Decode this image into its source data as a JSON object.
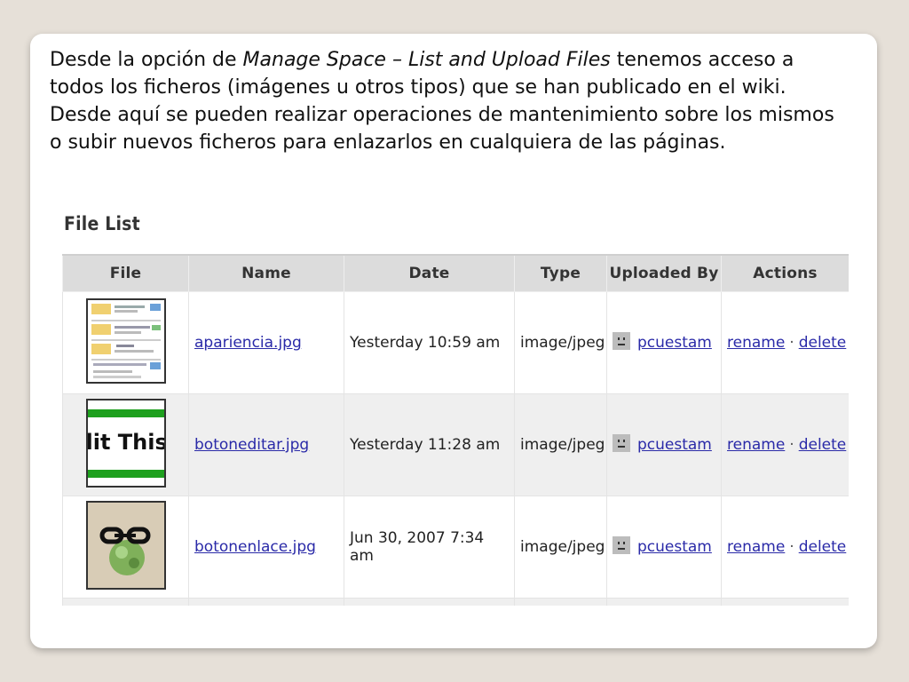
{
  "description": {
    "part1": "Desde la opción de ",
    "italic": "Manage Space – List and Upload Files",
    "part2": " tenemos acceso a todos los ficheros (imágenes u otros tipos) que se han publicado en el wiki. Desde aquí se pueden realizar operaciones de mantenimiento sobre los mismos o subir nuevos ficheros para enlazarlos en cualquiera de las páginas."
  },
  "file_list": {
    "title": "File List",
    "columns": [
      "File",
      "Name",
      "Date",
      "Type",
      "Uploaded By",
      "Actions"
    ],
    "rows": [
      {
        "thumb_icon": "screenshot-thumbnail-icon",
        "name": "apariencia.jpg",
        "date": "Yesterday 10:59 am",
        "type": "image/jpeg",
        "user": "pcuestam",
        "rename": "rename",
        "sep": "·",
        "delete": "delete"
      },
      {
        "thumb_icon": "edit-this-button-thumbnail-icon",
        "thumb_text": "lit This",
        "name": "botoneditar.jpg",
        "date": "Yesterday 11:28 am",
        "type": "image/jpeg",
        "user": "pcuestam",
        "rename": "rename",
        "sep": "·",
        "delete": "delete"
      },
      {
        "thumb_icon": "link-globe-thumbnail-icon",
        "name": "botonenlace.jpg",
        "date": "Jun 30, 2007 7:34 am",
        "type": "image/jpeg",
        "user": "pcuestam",
        "rename": "rename",
        "sep": "·",
        "delete": "delete"
      }
    ]
  },
  "colors": {
    "background": "#e6e0d8",
    "link": "#2a2aa8",
    "header_bg": "#dcdcdc",
    "alt_row_bg": "#efefef",
    "thumb_green": "#1ea01e"
  }
}
